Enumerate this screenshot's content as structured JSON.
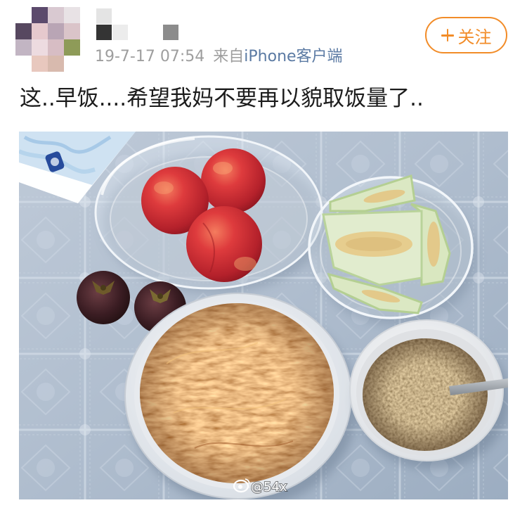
{
  "post": {
    "timestamp": "19-7-17 07:54",
    "source_prefix": "来自",
    "source_app": "iPhone客户端",
    "text": "这..早饭....希望我妈不要再以貌取饭量了.."
  },
  "follow_button": {
    "label": "关注",
    "icon": "plus-icon"
  },
  "image": {
    "watermark": "@54x",
    "watermark_icon": "weibo-logo-icon"
  },
  "colors": {
    "accent": "#f28c28",
    "link": "#5b7aa3",
    "meta": "#9e9e9e",
    "text": "#1c1c1c"
  }
}
